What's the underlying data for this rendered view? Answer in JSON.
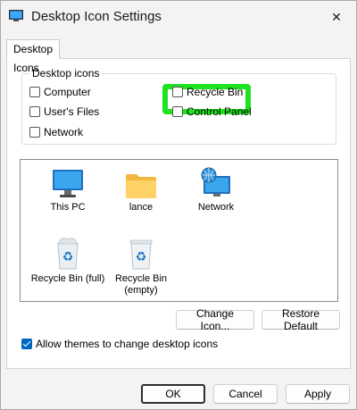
{
  "window": {
    "title": "Desktop Icon Settings",
    "close_glyph": "✕"
  },
  "tabs": [
    {
      "label": "Desktop Icons"
    }
  ],
  "desktop_icons_group": {
    "legend": "Desktop icons",
    "checkboxes": [
      {
        "label": "Computer",
        "checked": false
      },
      {
        "label": "User's Files",
        "checked": false
      },
      {
        "label": "Network",
        "checked": false
      },
      {
        "label": "Recycle Bin",
        "checked": false,
        "highlighted": true
      },
      {
        "label": "Control Panel",
        "checked": false
      }
    ]
  },
  "icon_list": [
    {
      "label": "This PC",
      "icon": "monitor-icon"
    },
    {
      "label": "lance",
      "icon": "folder-icon"
    },
    {
      "label": "Network",
      "icon": "network-globe-icon"
    },
    {
      "label": "Recycle Bin (full)",
      "icon": "recycle-bin-full-icon"
    },
    {
      "label": "Recycle Bin (empty)",
      "icon": "recycle-bin-empty-icon"
    }
  ],
  "buttons": {
    "change_icon": "Change Icon...",
    "restore_default": "Restore Default",
    "ok": "OK",
    "cancel": "Cancel",
    "apply": "Apply"
  },
  "allow_themes": {
    "label": "Allow themes to change desktop icons",
    "checked": true
  },
  "colors": {
    "highlight": "#1ee31e",
    "accent": "#0067c0"
  }
}
